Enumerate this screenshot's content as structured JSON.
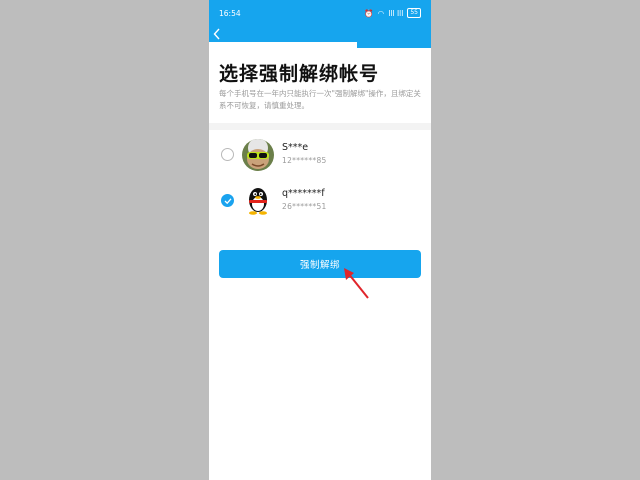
{
  "status_bar": {
    "time": "16:54",
    "signal_text": "Ill Ill",
    "battery": "55"
  },
  "nav": {
    "back_icon": "chevron-left-icon"
  },
  "header": {
    "title": "选择强制解绑帐号",
    "subtitle": "每个手机号在一年内只能执行一次\"强制解绑\"操作，且绑定关系不可恢复，请慎重处理。"
  },
  "accounts": [
    {
      "name": "S***e",
      "id": "12******85",
      "selected": false
    },
    {
      "name": "q*******f",
      "id": "26******51",
      "selected": true
    }
  ],
  "actions": {
    "force_unbind_label": "强制解绑"
  },
  "colors": {
    "accent": "#16a5ee",
    "annotation": "#e0252b"
  }
}
